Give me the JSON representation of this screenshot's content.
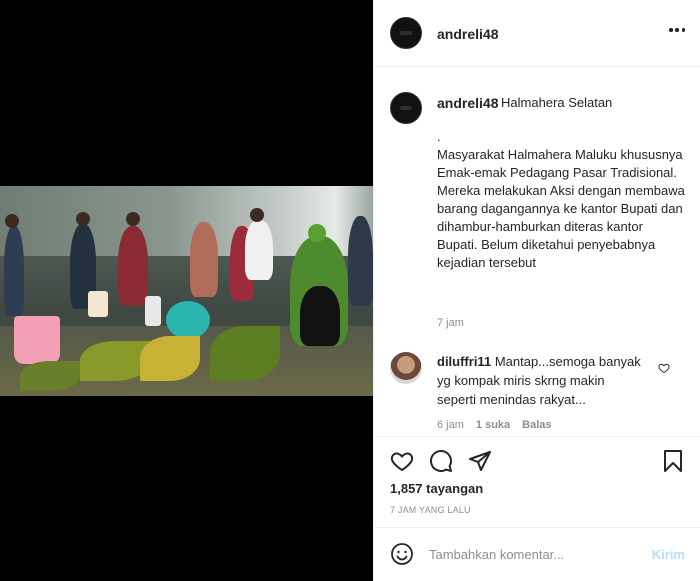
{
  "post": {
    "username": "andreli48",
    "location": "Halmahera Selatan",
    "caption": ".\nMasyarakat Halmahera Maluku khususnya Emak-emak Pedagang Pasar Tradisional.\nMereka melakukan Aksi dengan membawa barang dagangannya ke kantor Bupati dan dihambur-hamburkan diteras kantor Bupati. Belum diketahui penyebabnya kejadian tersebut",
    "caption_time": "7 jam",
    "views": "1,857 tayangan",
    "time_ago": "7 JAM YANG LALU"
  },
  "comment": {
    "username": "diluffri11",
    "text": "Mantap...semoga banyak yg kompak miris skrng makin seperti menindas rakyat...",
    "time": "6 jam",
    "likes": "1 suka",
    "reply": "Balas"
  },
  "add_comment": {
    "placeholder": "Tambahkan komentar...",
    "post_label": "Kirim"
  },
  "colors": {
    "text": "#262626",
    "muted": "#8e8e8e",
    "post_disabled": "#b2dffc",
    "border": "#efefef"
  },
  "icons": [
    "more-icon",
    "heart-icon",
    "comment-icon",
    "share-icon",
    "bookmark-icon",
    "emoji-icon",
    "heart-small-icon"
  ]
}
